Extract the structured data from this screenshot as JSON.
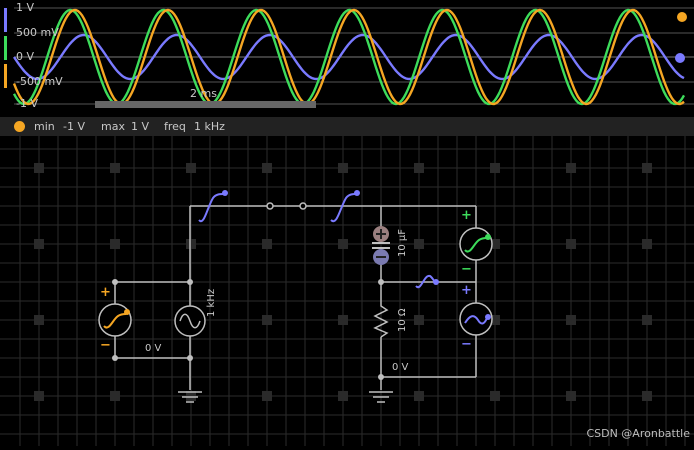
{
  "scope": {
    "y_ticks": [
      "1 V",
      "500 mV",
      "0 V",
      "-500 mV",
      "-1 V"
    ],
    "time_scale_label": "2 ms",
    "series": [
      {
        "color": "#7a7aff",
        "role": "source-voltage"
      },
      {
        "color": "#3ddc5b",
        "role": "capacitor-voltage"
      },
      {
        "color": "#f5a623",
        "role": "resistor-voltage"
      }
    ]
  },
  "status": {
    "min_label": "min",
    "min_value": "-1 V",
    "max_label": "max",
    "max_value": "1 V",
    "freq_label": "freq",
    "freq_value": "1 kHz"
  },
  "circuit": {
    "source_label": "1 kHz",
    "capacitor_label": "10 µF",
    "resistor_label": "10 Ω",
    "ground_left_label": "0 V",
    "ground_right_label": "0 V",
    "plus": "+",
    "minus": "−"
  },
  "watermark": "CSDN @Aronbattle"
}
